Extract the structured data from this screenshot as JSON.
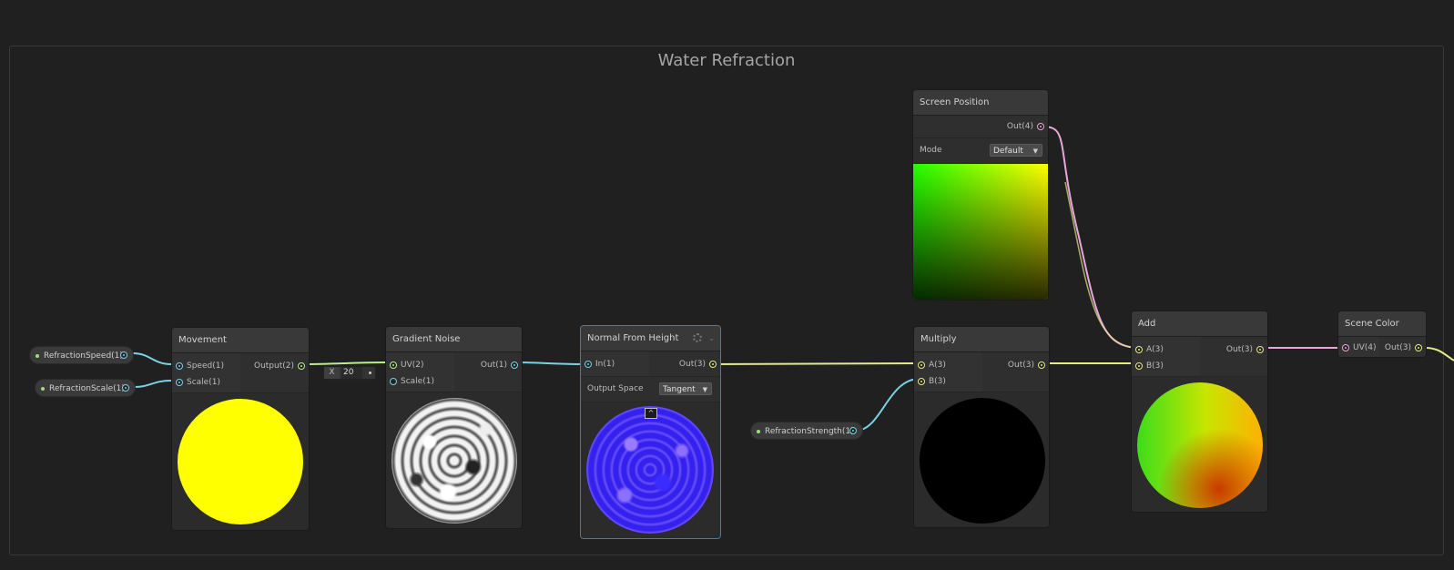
{
  "group": {
    "title": "Water Refraction"
  },
  "properties": {
    "speed": "RefractionSpeed(1)",
    "scale": "RefractionScale(1)",
    "strength": "RefractionStrength(1)"
  },
  "nodes": {
    "movement": {
      "title": "Movement",
      "in1": "Speed(1)",
      "in2": "Scale(1)",
      "out": "Output(2)",
      "preview_color": "#ffff00"
    },
    "gradient_noise": {
      "title": "Gradient Noise",
      "in1": "UV(2)",
      "in2": "Scale(1)",
      "out": "Out(1)",
      "scale_field_label": "X",
      "scale_value": "20"
    },
    "normal_from_height": {
      "title": "Normal From Height",
      "in1": "In(1)",
      "out": "Out(3)",
      "output_space_label": "Output Space",
      "output_space_value": "Tangent"
    },
    "screen_position": {
      "title": "Screen Position",
      "out": "Out(4)",
      "mode_label": "Mode",
      "mode_value": "Default"
    },
    "multiply": {
      "title": "Multiply",
      "in1": "A(3)",
      "in2": "B(3)",
      "out": "Out(3)",
      "preview_color": "#000000"
    },
    "add": {
      "title": "Add",
      "in1": "A(3)",
      "in2": "B(3)",
      "out": "Out(3)"
    },
    "scene_color": {
      "title": "Scene Color",
      "in1": "UV(4)",
      "out": "Out(3)"
    }
  },
  "icons": {
    "gear": "gear-icon",
    "chevron": "chevron-down-icon",
    "collapse": "chevron-up-icon"
  },
  "colors": {
    "float_wire": "#7ad3e5",
    "vector_wire": "#e6ea8c",
    "vector2_wire": "#b8f08a",
    "vector4_wire": "#e8a7d8",
    "selection": "#3d7db3"
  }
}
